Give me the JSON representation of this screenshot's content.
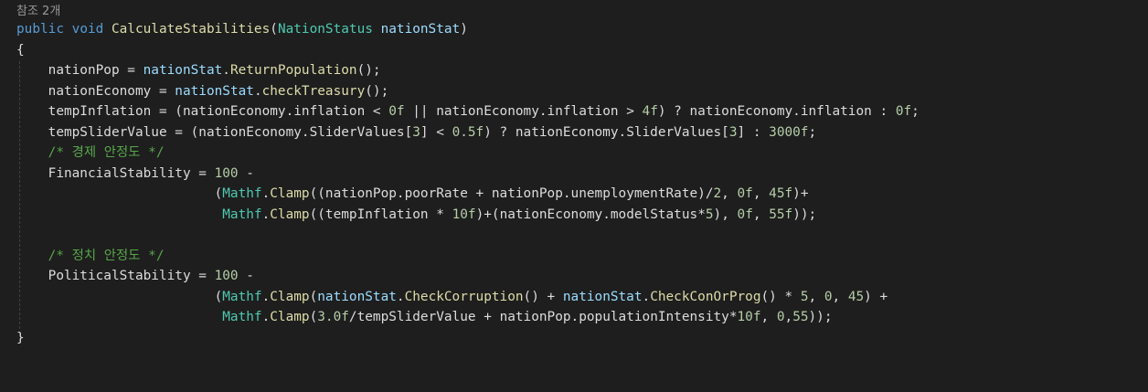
{
  "codelens": "참조 2개",
  "lines": [
    [
      [
        "kw",
        "public"
      ],
      [
        "op",
        " "
      ],
      [
        "kw",
        "void"
      ],
      [
        "op",
        " "
      ],
      [
        "fn",
        "CalculateStabilities"
      ],
      [
        "op",
        "("
      ],
      [
        "ty",
        "NationStatus"
      ],
      [
        "op",
        " "
      ],
      [
        "par",
        "nationStat"
      ],
      [
        "op",
        ")"
      ]
    ],
    [
      [
        "op",
        "{"
      ]
    ],
    [
      [
        "op",
        "    "
      ],
      [
        "id",
        "nationPop"
      ],
      [
        "op",
        " = "
      ],
      [
        "par",
        "nationStat"
      ],
      [
        "op",
        "."
      ],
      [
        "fn",
        "ReturnPopulation"
      ],
      [
        "op",
        "();"
      ]
    ],
    [
      [
        "op",
        "    "
      ],
      [
        "id",
        "nationEconomy"
      ],
      [
        "op",
        " = "
      ],
      [
        "par",
        "nationStat"
      ],
      [
        "op",
        "."
      ],
      [
        "fn",
        "checkTreasury"
      ],
      [
        "op",
        "();"
      ]
    ],
    [
      [
        "op",
        "    "
      ],
      [
        "id",
        "tempInflation"
      ],
      [
        "op",
        " = ("
      ],
      [
        "id",
        "nationEconomy"
      ],
      [
        "op",
        "."
      ],
      [
        "id",
        "inflation"
      ],
      [
        "op",
        " < "
      ],
      [
        "num",
        "0f"
      ],
      [
        "op",
        " || "
      ],
      [
        "id",
        "nationEconomy"
      ],
      [
        "op",
        "."
      ],
      [
        "id",
        "inflation"
      ],
      [
        "op",
        " > "
      ],
      [
        "num",
        "4f"
      ],
      [
        "op",
        ") ? "
      ],
      [
        "id",
        "nationEconomy"
      ],
      [
        "op",
        "."
      ],
      [
        "id",
        "inflation"
      ],
      [
        "op",
        " : "
      ],
      [
        "num",
        "0f"
      ],
      [
        "op",
        ";"
      ]
    ],
    [
      [
        "op",
        "    "
      ],
      [
        "id",
        "tempSliderValue"
      ],
      [
        "op",
        " = ("
      ],
      [
        "id",
        "nationEconomy"
      ],
      [
        "op",
        "."
      ],
      [
        "id",
        "SliderValues"
      ],
      [
        "op",
        "["
      ],
      [
        "num",
        "3"
      ],
      [
        "op",
        "] < "
      ],
      [
        "num",
        "0.5f"
      ],
      [
        "op",
        ") ? "
      ],
      [
        "id",
        "nationEconomy"
      ],
      [
        "op",
        "."
      ],
      [
        "id",
        "SliderValues"
      ],
      [
        "op",
        "["
      ],
      [
        "num",
        "3"
      ],
      [
        "op",
        "] : "
      ],
      [
        "num",
        "3000f"
      ],
      [
        "op",
        ";"
      ]
    ],
    [
      [
        "op",
        "    "
      ],
      [
        "cm",
        "/* 경제 안정도 */"
      ]
    ],
    [
      [
        "op",
        "    "
      ],
      [
        "id",
        "FinancialStability"
      ],
      [
        "op",
        " = "
      ],
      [
        "num",
        "100"
      ],
      [
        "op",
        " -"
      ]
    ],
    [
      [
        "op",
        "                         ("
      ],
      [
        "ty",
        "Mathf"
      ],
      [
        "op",
        "."
      ],
      [
        "fn",
        "Clamp"
      ],
      [
        "op",
        "(("
      ],
      [
        "id",
        "nationPop"
      ],
      [
        "op",
        "."
      ],
      [
        "id",
        "poorRate"
      ],
      [
        "op",
        " + "
      ],
      [
        "id",
        "nationPop"
      ],
      [
        "op",
        "."
      ],
      [
        "id",
        "unemploymentRate"
      ],
      [
        "op",
        ")/"
      ],
      [
        "num",
        "2"
      ],
      [
        "op",
        ", "
      ],
      [
        "num",
        "0f"
      ],
      [
        "op",
        ", "
      ],
      [
        "num",
        "45f"
      ],
      [
        "op",
        ")+"
      ]
    ],
    [
      [
        "op",
        "                          "
      ],
      [
        "ty",
        "Mathf"
      ],
      [
        "op",
        "."
      ],
      [
        "fn",
        "Clamp"
      ],
      [
        "op",
        "(("
      ],
      [
        "id",
        "tempInflation"
      ],
      [
        "op",
        " * "
      ],
      [
        "num",
        "10f"
      ],
      [
        "op",
        ")+("
      ],
      [
        "id",
        "nationEconomy"
      ],
      [
        "op",
        "."
      ],
      [
        "id",
        "modelStatus"
      ],
      [
        "op",
        "*"
      ],
      [
        "num",
        "5"
      ],
      [
        "op",
        "), "
      ],
      [
        "num",
        "0f"
      ],
      [
        "op",
        ", "
      ],
      [
        "num",
        "55f"
      ],
      [
        "op",
        "));"
      ]
    ],
    [],
    [
      [
        "op",
        "    "
      ],
      [
        "cm",
        "/* 정치 안정도 */"
      ]
    ],
    [
      [
        "op",
        "    "
      ],
      [
        "id",
        "PoliticalStability"
      ],
      [
        "op",
        " = "
      ],
      [
        "num",
        "100"
      ],
      [
        "op",
        " -"
      ]
    ],
    [
      [
        "op",
        "                         ("
      ],
      [
        "ty",
        "Mathf"
      ],
      [
        "op",
        "."
      ],
      [
        "fn",
        "Clamp"
      ],
      [
        "op",
        "("
      ],
      [
        "par",
        "nationStat"
      ],
      [
        "op",
        "."
      ],
      [
        "fn",
        "CheckCorruption"
      ],
      [
        "op",
        "() + "
      ],
      [
        "par",
        "nationStat"
      ],
      [
        "op",
        "."
      ],
      [
        "fn",
        "CheckConOrProg"
      ],
      [
        "op",
        "() * "
      ],
      [
        "num",
        "5"
      ],
      [
        "op",
        ", "
      ],
      [
        "num",
        "0"
      ],
      [
        "op",
        ", "
      ],
      [
        "num",
        "45"
      ],
      [
        "op",
        ") +"
      ]
    ],
    [
      [
        "op",
        "                          "
      ],
      [
        "ty",
        "Mathf"
      ],
      [
        "op",
        "."
      ],
      [
        "fn",
        "Clamp"
      ],
      [
        "op",
        "("
      ],
      [
        "num",
        "3.0f"
      ],
      [
        "op",
        "/"
      ],
      [
        "id",
        "tempSliderValue"
      ],
      [
        "op",
        " + "
      ],
      [
        "id",
        "nationPop"
      ],
      [
        "op",
        "."
      ],
      [
        "id",
        "populationIntensity"
      ],
      [
        "op",
        "*"
      ],
      [
        "num",
        "10f"
      ],
      [
        "op",
        ", "
      ],
      [
        "num",
        "0"
      ],
      [
        "op",
        ","
      ],
      [
        "num",
        "55"
      ],
      [
        "op",
        "));"
      ]
    ],
    [
      [
        "op",
        "}"
      ]
    ]
  ]
}
